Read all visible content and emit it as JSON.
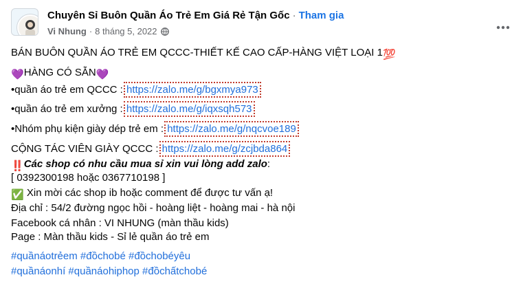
{
  "group": {
    "name": "Chuyên Sỉ Buôn Quần Áo Trẻ Em Giá Rẻ Tận Gốc",
    "separator": "·",
    "join_label": "Tham gia"
  },
  "post_meta": {
    "author": "Vi Nhung",
    "separator": "·",
    "date": "8 tháng 5, 2022",
    "privacy_icon": "globe-icon"
  },
  "more_icon": "more-dots-icon",
  "lines": {
    "l1": "BÁN BUÔN QUẦN ÁO TRẺ EM QCCC-THIẾT KẾ CAO CẤP-HÀNG VIỆT LOẠI 1",
    "l1_emoji": "💯",
    "l2_emoji_left": "💜",
    "l2": "HÀNG CÓ SẴN",
    "l2_emoji_right": "💜",
    "l3_text": "•quần áo trẻ em QCCC : ",
    "l3_link": "https://zalo.me/g/bgxmya973",
    "l4_text": "•quần áo trẻ em xưởng : ",
    "l4_link": "https://zalo.me/g/iqxsqh573",
    "l5_text": "•Nhóm phụ kiện giày dép trẻ em : ",
    "l5_link": "https://zalo.me/g/nqcvoe189",
    "l6_text": "CỘNG TÁC VIÊN GIÀY QCCC : ",
    "l6_link": "https://zalo.me/g/zcjbda864",
    "l7_emoji": "‼️",
    "l7": "Các shop có nhu cầu mua sỉ xin vui lòng add zalo",
    "l7_tail": ":",
    "l8": " [ 0392300198 hoặc 0367710198 ]",
    "l9_emoji": "✅",
    "l9": " Xin mời các shop ib hoặc comment để được tư vấn ạ!",
    "l10": "Địa chỉ : 54/2 đường ngọc hồi - hoàng liệt - hoàng mai - hà nội",
    "l11": "Facebook cá nhân : VI NHUNG (màn thầu kids)",
    "l12": "Page : Màn thầu kids - Sỉ lẻ quần áo trẻ em"
  },
  "hashtags": {
    "row1": [
      "#quầnáotrẻem",
      "#đồchobé",
      "#đồchobéyêu"
    ],
    "row2": [
      "#quầnáonhí",
      "#quầnáohiphop",
      "#đồchấtchobé"
    ]
  }
}
